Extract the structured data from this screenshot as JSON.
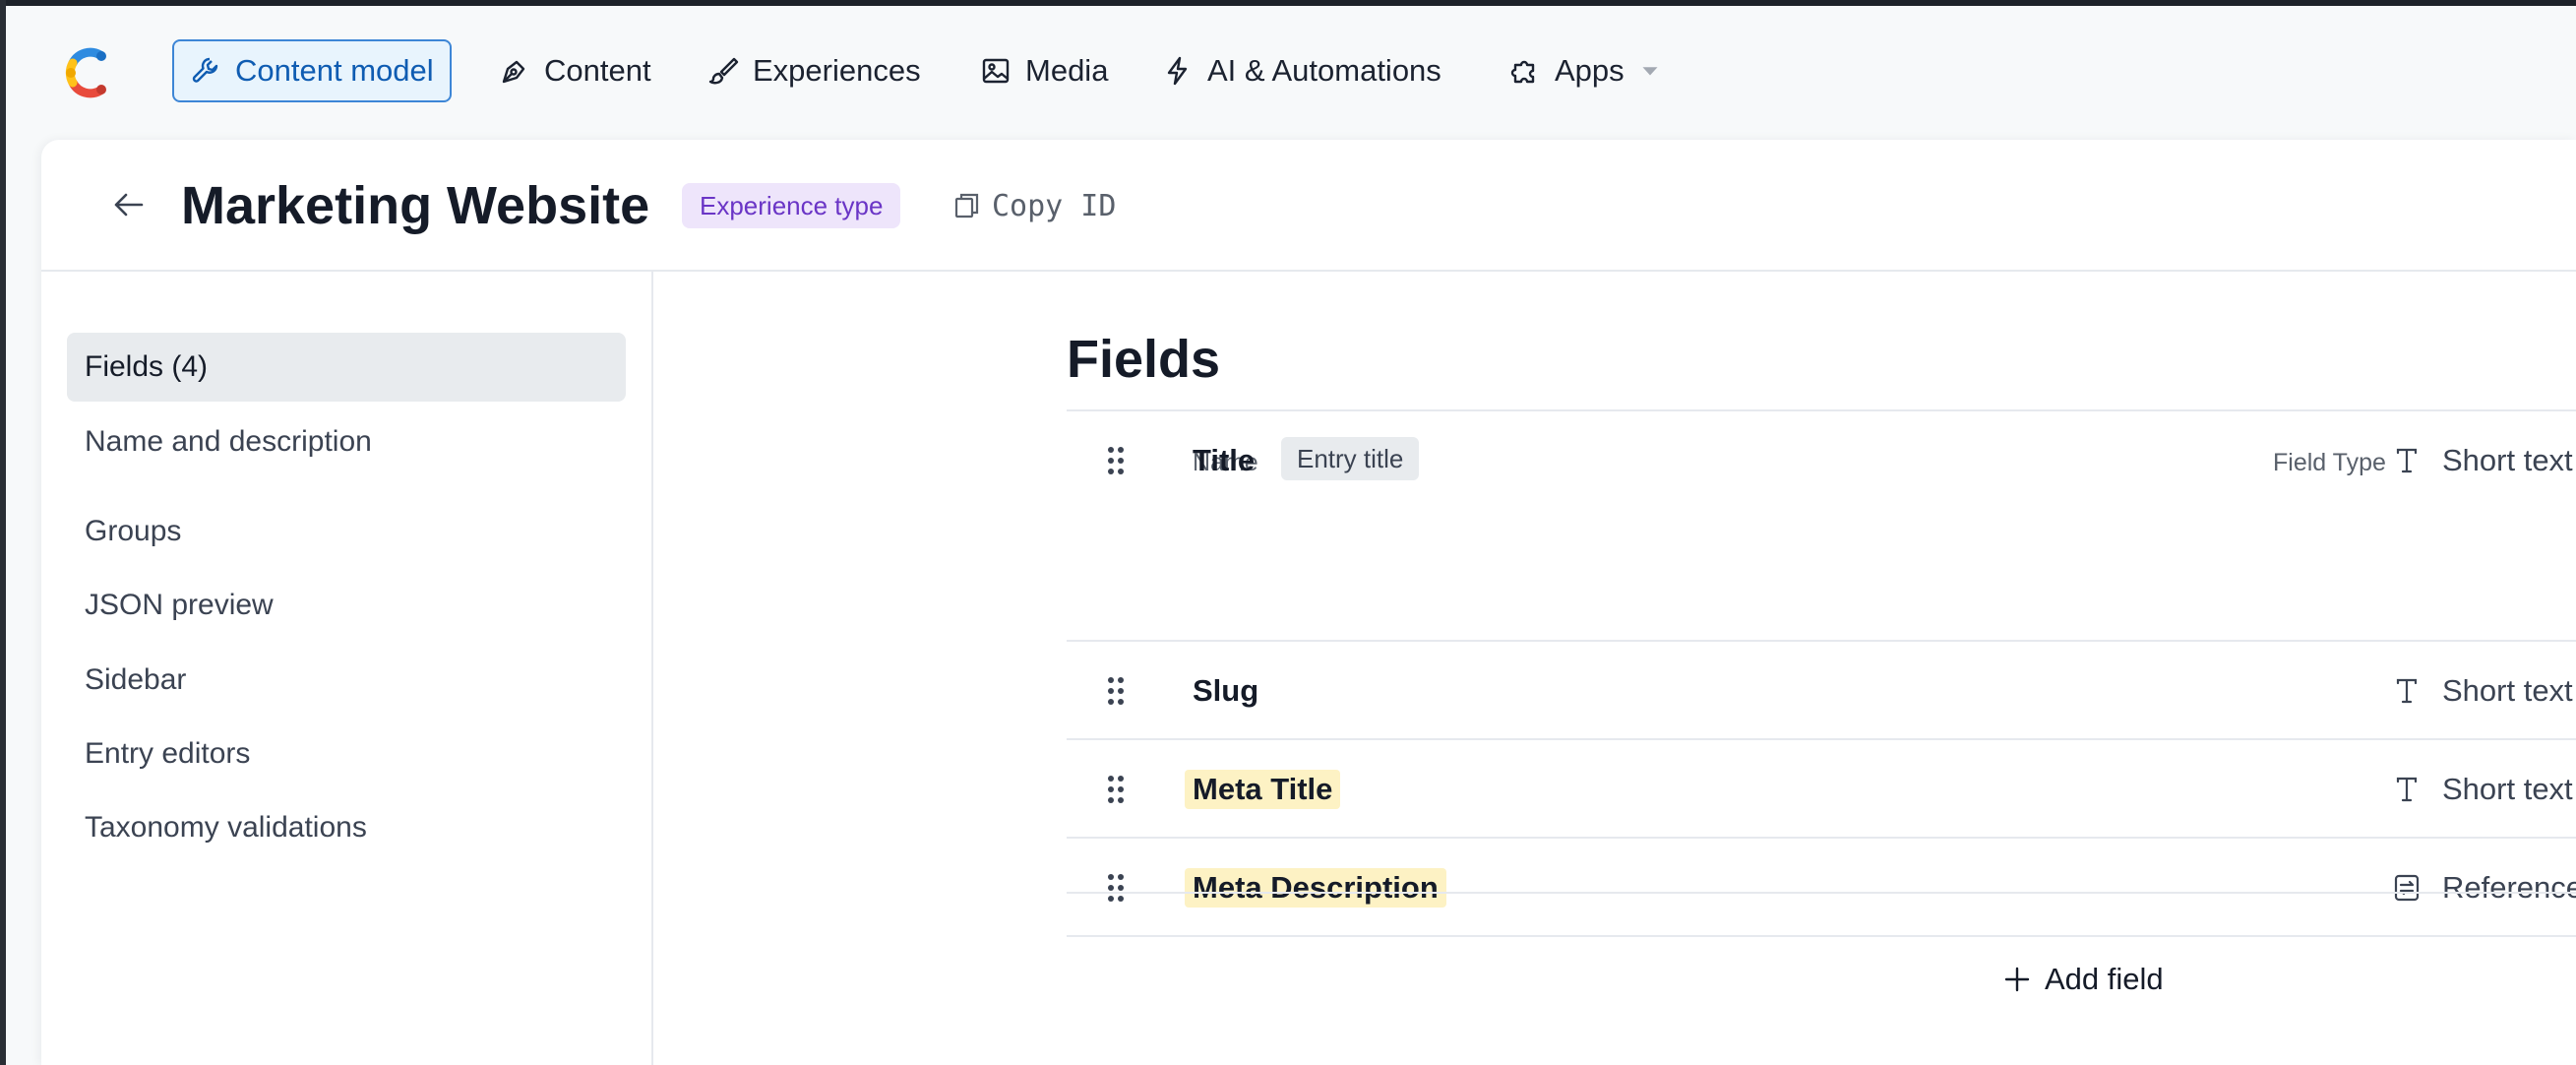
{
  "nav": {
    "items": [
      {
        "label": "Content model",
        "icon": "wrench-icon",
        "active": true
      },
      {
        "label": "Content",
        "icon": "pen-nib-icon"
      },
      {
        "label": "Experiences",
        "icon": "brush-icon"
      },
      {
        "label": "Media",
        "icon": "image-icon"
      },
      {
        "label": "AI & Automations",
        "icon": "lightning-icon"
      },
      {
        "label": "Apps",
        "icon": "puzzle-icon"
      }
    ]
  },
  "header": {
    "title": "Marketing Website",
    "badge": "Experience type",
    "copy_id": "Copy ID"
  },
  "sidebar": {
    "items": [
      {
        "label": "Fields (4)",
        "active": true
      },
      {
        "label": "Name and description"
      },
      {
        "label": "Groups"
      },
      {
        "label": "JSON preview"
      },
      {
        "label": "Sidebar"
      },
      {
        "label": "Entry editors"
      },
      {
        "label": "Taxonomy validations"
      }
    ]
  },
  "fields": {
    "title": "Fields",
    "columns": {
      "name": "Name",
      "type": "Field Type"
    },
    "rows": [
      {
        "name": "Title",
        "tag": "Entry title",
        "type": "Short text",
        "type_icon": "text-t-icon"
      },
      {
        "name": "Slug",
        "type": "Short text",
        "type_icon": "text-t-icon"
      },
      {
        "name": "Meta Title",
        "type": "Short text",
        "type_icon": "text-t-icon",
        "highlighted": true
      },
      {
        "name": "Meta Description",
        "type": "Reference",
        "type_icon": "reference-icon",
        "highlighted": true
      }
    ],
    "add_label": "Add field"
  },
  "colors": {
    "accent": "#0f5cb2",
    "accent_bg": "#e8f4fd",
    "badge_purple": "#6a35c6",
    "highlight": "#fdf2c4"
  }
}
